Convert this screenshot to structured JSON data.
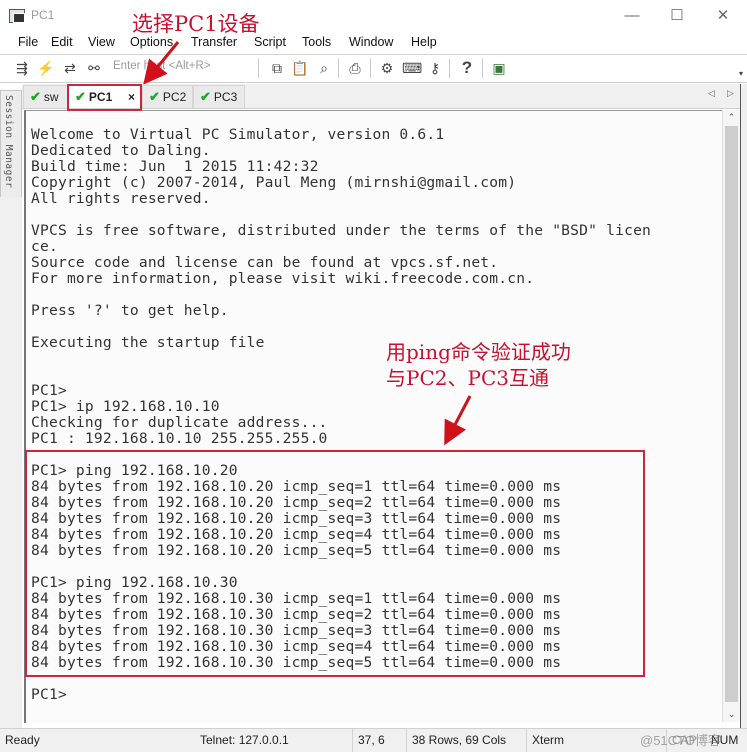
{
  "window": {
    "title": "PC1",
    "minimize_glyph": "—",
    "maximize_glyph": "☐",
    "close_glyph": "✕"
  },
  "menu": [
    "File",
    "Edit",
    "View",
    "Options",
    "Transfer",
    "Script",
    "Tools",
    "Window",
    "Help"
  ],
  "toolbar": {
    "host_placeholder": "Enter host <Alt+R>",
    "icons": {
      "connect": "⇶",
      "quick_connect": "⚡",
      "reconnect": "⇄",
      "disconnect": "⚯",
      "copy": "⧉",
      "paste": "📋",
      "find": "⌕",
      "print": "⎙",
      "settings": "⚙",
      "keymap": "⌨",
      "key": "⚷",
      "help": "?",
      "sftp": "▣",
      "more": "▾"
    }
  },
  "tabs": [
    {
      "label": "sw",
      "active": false,
      "check": "✔"
    },
    {
      "label": "PC1",
      "active": true,
      "check": "✔",
      "close": "×"
    },
    {
      "label": "PC2",
      "active": false,
      "check": "✔"
    },
    {
      "label": "PC3",
      "active": false,
      "check": "✔"
    }
  ],
  "tab_nav": {
    "prev": "◁",
    "next": "▷"
  },
  "session_manager": "Session Manager",
  "terminal": {
    "lines": [
      "Welcome to Virtual PC Simulator, version 0.6.1",
      "Dedicated to Daling.",
      "Build time: Jun  1 2015 11:42:32",
      "Copyright (c) 2007-2014, Paul Meng (mirnshi@gmail.com)",
      "All rights reserved.",
      "",
      "VPCS is free software, distributed under the terms of the \"BSD\" licen",
      "ce.",
      "Source code and license can be found at vpcs.sf.net.",
      "For more information, please visit wiki.freecode.com.cn.",
      "",
      "Press '?' to get help.",
      "",
      "Executing the startup file",
      "",
      "",
      "PC1>",
      "PC1> ip 192.168.10.10",
      "Checking for duplicate address...",
      "PC1 : 192.168.10.10 255.255.255.0",
      "",
      "PC1> ping 192.168.10.20",
      "84 bytes from 192.168.10.20 icmp_seq=1 ttl=64 time=0.000 ms",
      "84 bytes from 192.168.10.20 icmp_seq=2 ttl=64 time=0.000 ms",
      "84 bytes from 192.168.10.20 icmp_seq=3 ttl=64 time=0.000 ms",
      "84 bytes from 192.168.10.20 icmp_seq=4 ttl=64 time=0.000 ms",
      "84 bytes from 192.168.10.20 icmp_seq=5 ttl=64 time=0.000 ms",
      "",
      "PC1> ping 192.168.10.30",
      "84 bytes from 192.168.10.30 icmp_seq=1 ttl=64 time=0.000 ms",
      "84 bytes from 192.168.10.30 icmp_seq=2 ttl=64 time=0.000 ms",
      "84 bytes from 192.168.10.30 icmp_seq=3 ttl=64 time=0.000 ms",
      "84 bytes from 192.168.10.30 icmp_seq=4 ttl=64 time=0.000 ms",
      "84 bytes from 192.168.10.30 icmp_seq=5 ttl=64 time=0.000 ms",
      "",
      "PC1>"
    ]
  },
  "scrollbar": {
    "up": "⌃",
    "down": "⌄"
  },
  "status": {
    "ready": "Ready",
    "connection": "Telnet: 127.0.0.1",
    "cursor": "37,   6",
    "size": "38 Rows, 69 Cols",
    "terminal_type": "Xterm",
    "caps": "CAP",
    "num": "NUM"
  },
  "watermark": "@51CTO博客",
  "annotations": {
    "select_pc1": "选择PC1设备",
    "ping_line1": "用ping命令验证成功",
    "ping_line2": "与PC2、PC3互通",
    "color": "#c8102e"
  }
}
